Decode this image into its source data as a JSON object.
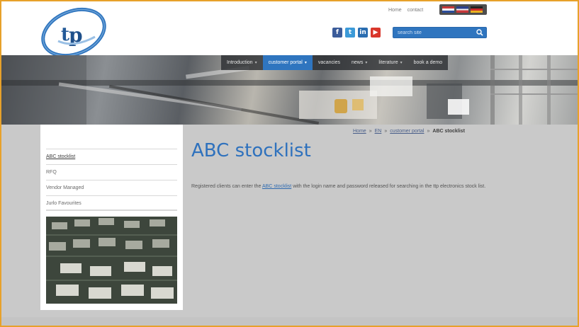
{
  "header": {
    "top_links": [
      "Home",
      "contact"
    ],
    "language_flags": [
      "nl-flag",
      "en-flag",
      "de-flag"
    ],
    "social_icons": [
      "facebook-icon",
      "twitter-icon",
      "linkedin-icon",
      "youtube-icon"
    ],
    "search": {
      "placeholder": "search site",
      "icon": "search-icon"
    },
    "brand_color": "#2f75bf"
  },
  "nav": {
    "items": [
      {
        "label": "Introduction",
        "has_menu": true
      },
      {
        "label": "customer portal",
        "has_menu": true,
        "active": true
      },
      {
        "label": "vacancies",
        "has_menu": false
      },
      {
        "label": "news",
        "has_menu": true
      },
      {
        "label": "literature",
        "has_menu": true
      },
      {
        "label": "book a demo",
        "has_menu": false
      }
    ],
    "active_color": "#2f75bf"
  },
  "sidebar": {
    "items": [
      {
        "label": "ABC stocklist"
      },
      {
        "label": "RFQ"
      },
      {
        "label": "Vendor Managed"
      },
      {
        "label": "Jurlo Favourites"
      }
    ]
  },
  "breadcrumb": {
    "items": [
      "Home",
      "EN",
      "customer portal"
    ],
    "current": "ABC stocklist"
  },
  "main": {
    "title": "ABC stocklist",
    "text_before": "Registered clients can enter the ",
    "link": "ABC stocklist",
    "text_after": " with the login name and password released for searching in the ttp electronics stock list."
  },
  "colors": {
    "title_blue": "#2e71bd",
    "page_background": "#c9c9c9",
    "frame_orange": "#e7a12a"
  }
}
